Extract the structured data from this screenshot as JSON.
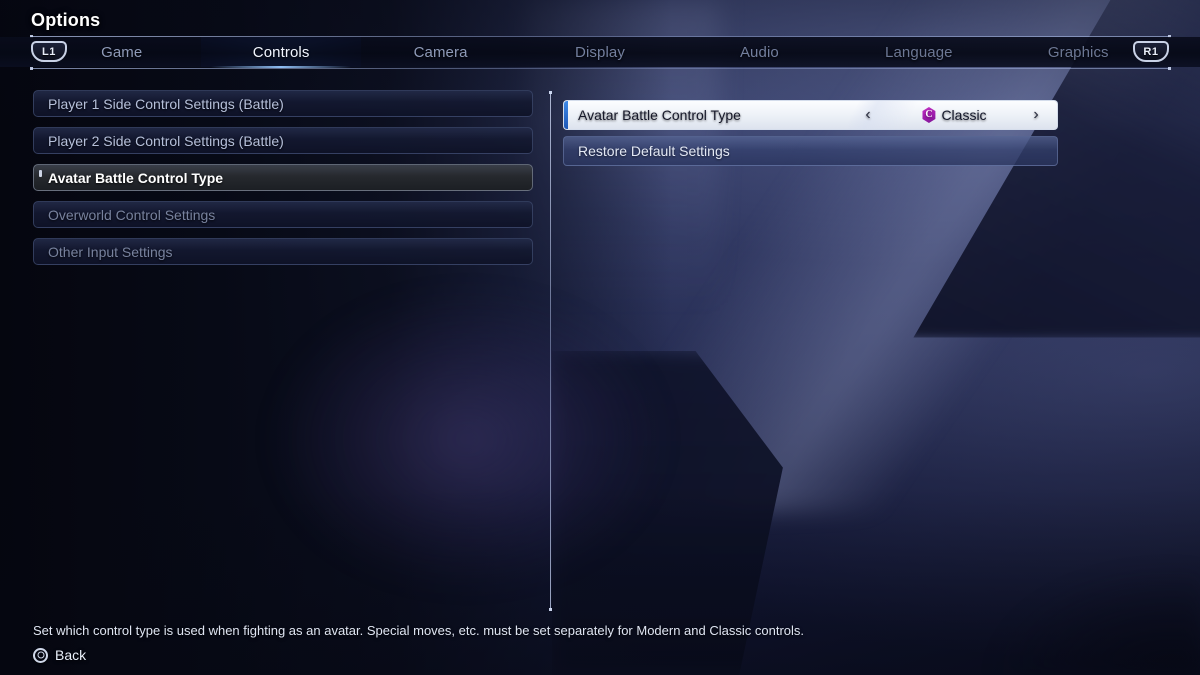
{
  "header": {
    "title": "Options",
    "left_bumper": "L1",
    "right_bumper": "R1",
    "tabs": [
      {
        "label": "Game",
        "active": false
      },
      {
        "label": "Controls",
        "active": true
      },
      {
        "label": "Camera",
        "active": false
      },
      {
        "label": "Display",
        "active": false
      },
      {
        "label": "Audio",
        "active": false
      },
      {
        "label": "Language",
        "active": false
      },
      {
        "label": "Graphics",
        "active": false
      }
    ]
  },
  "left_panel": {
    "items": [
      {
        "label": "Player 1 Side Control Settings (Battle)",
        "selected": false,
        "dimmed": false
      },
      {
        "label": "Player 2 Side Control Settings (Battle)",
        "selected": false,
        "dimmed": false
      },
      {
        "label": "Avatar Battle Control Type",
        "selected": true,
        "dimmed": false
      },
      {
        "label": "Overworld Control Settings",
        "selected": false,
        "dimmed": true
      },
      {
        "label": "Other Input Settings",
        "selected": false,
        "dimmed": true
      }
    ]
  },
  "right_panel": {
    "rows": [
      {
        "label": "Avatar Battle Control Type",
        "type": "option",
        "value": "Classic",
        "value_badge": "C",
        "left_arrow": "‹",
        "right_arrow": "›",
        "highlighted": true
      },
      {
        "label": "Restore Default Settings",
        "type": "plain",
        "highlighted": false
      }
    ]
  },
  "footer": {
    "description": "Set which control type is used when fighting as an avatar. Special moves, etc. must be set separately for Modern and Classic controls.",
    "back_label": "Back",
    "back_button_icon": "circle-button-icon"
  },
  "colors": {
    "accent_blue": "#3f8ae8",
    "tab_active_glow": "#1c4ab0",
    "badge_purple": "#a41fb2",
    "panel_dark": "#181e38",
    "selected_row_dark": "#26292e"
  }
}
